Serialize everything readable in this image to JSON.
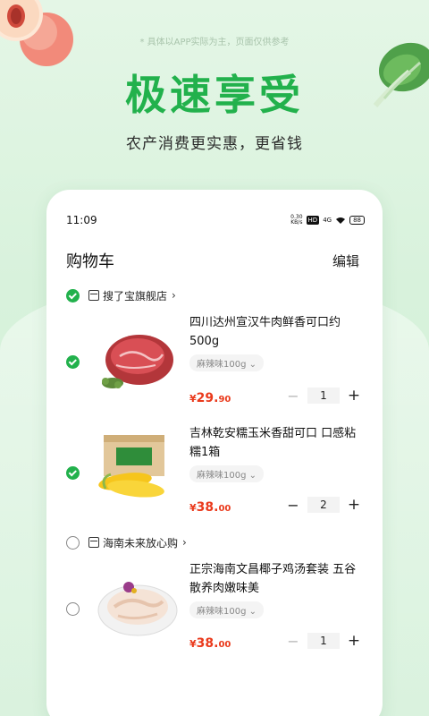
{
  "promo": {
    "disclaimer": "* 具体以APP实际为主，页面仅供参考",
    "headline": "极速享受",
    "subline": "农产消费更实惠，更省钱"
  },
  "status_bar": {
    "time": "11:09",
    "speed": "0.30",
    "speed_unit": "KB/s",
    "hd_tag": "HD",
    "network": "4G",
    "battery": "88"
  },
  "nav": {
    "title": "购物车",
    "edit_label": "编辑"
  },
  "shops": [
    {
      "name": "搜了宝旗舰店",
      "checked": true,
      "items": [
        {
          "name": "四川达州宣汉牛肉鲜香可口约500g",
          "spec": "麻辣味100g",
          "price_currency": "¥",
          "price_int": "29.",
          "price_dec": "90",
          "quantity": "1",
          "checked": true,
          "image_icon": "beef-icon"
        },
        {
          "name": "吉林乾安糯玉米香甜可口 口感粘糯1箱",
          "spec": "麻辣味100g",
          "price_currency": "¥",
          "price_int": "38.",
          "price_dec": "00",
          "quantity": "2",
          "checked": true,
          "image_icon": "corn-icon"
        }
      ]
    },
    {
      "name": "海南未来放心购",
      "checked": false,
      "items": [
        {
          "name": "正宗海南文昌椰子鸡汤套装 五谷散养肉嫩味美",
          "spec": "麻辣味100g",
          "price_currency": "¥",
          "price_int": "38.",
          "price_dec": "00",
          "quantity": "1",
          "checked": false,
          "image_icon": "chicken-icon"
        }
      ]
    }
  ],
  "colors": {
    "brand_green": "#22b14c",
    "price_red": "#ea3a1c"
  }
}
